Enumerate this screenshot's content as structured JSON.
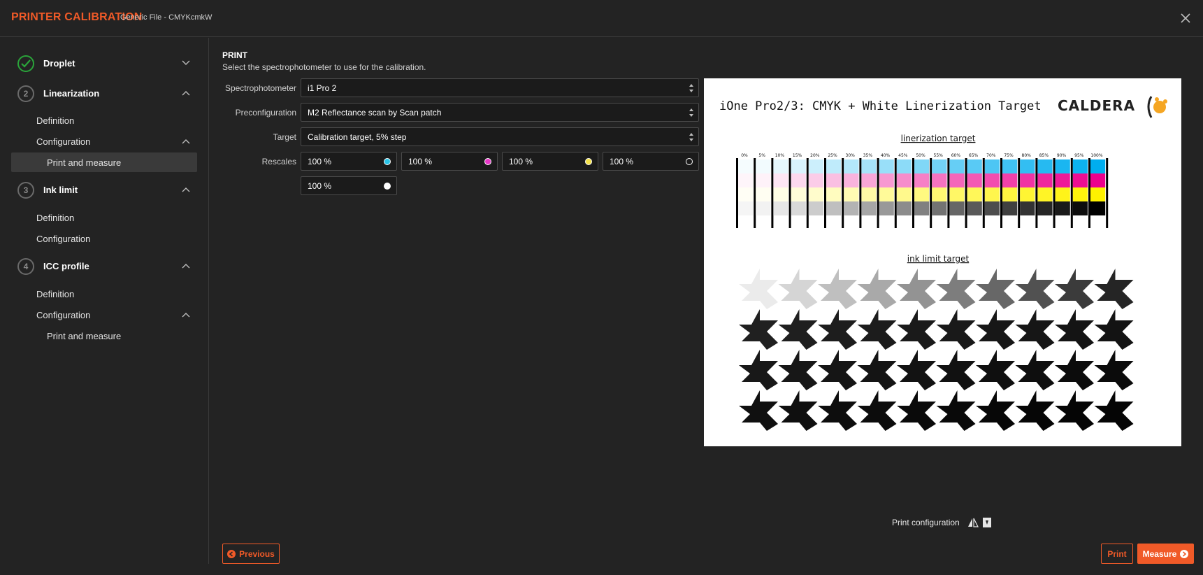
{
  "header": {
    "title": "PRINTER CALIBRATION",
    "subtitle": "Generic File - CMYKcmkW",
    "close_icon": "close-icon"
  },
  "sidebar": {
    "steps": [
      {
        "number": "",
        "label": "Droplet",
        "status": "done",
        "expanded": false
      },
      {
        "number": "2",
        "label": "Linearization",
        "status": "pending",
        "expanded": true,
        "items": [
          {
            "label": "Definition"
          },
          {
            "label": "Configuration",
            "expanded": true,
            "children": [
              {
                "label": "Print and measure",
                "active": true
              }
            ]
          }
        ]
      },
      {
        "number": "3",
        "label": "Ink limit",
        "status": "pending",
        "expanded": true,
        "items": [
          {
            "label": "Definition"
          },
          {
            "label": "Configuration"
          }
        ]
      },
      {
        "number": "4",
        "label": "ICC profile",
        "status": "pending",
        "expanded": true,
        "items": [
          {
            "label": "Definition"
          },
          {
            "label": "Configuration",
            "expanded": true,
            "children": [
              {
                "label": "Print and measure"
              }
            ]
          }
        ]
      }
    ]
  },
  "main": {
    "section_title": "PRINT",
    "section_desc": "Select the spectrophotometer to use for the calibration.",
    "fields": {
      "spectrophotometer": {
        "label": "Spectrophotometer",
        "value": "i1 Pro 2"
      },
      "preconfiguration": {
        "label": "Preconfiguration",
        "value": "M2 Reflectance scan by Scan patch"
      },
      "target": {
        "label": "Target",
        "value": "Calibration target, 5% step"
      },
      "rescales": {
        "label": "Rescales",
        "items": [
          {
            "value": "100 %",
            "color": "#29c4e8",
            "ink": "cyan"
          },
          {
            "value": "100 %",
            "color": "#e838c8",
            "ink": "magenta"
          },
          {
            "value": "100 %",
            "color": "#f4e24a",
            "ink": "yellow"
          },
          {
            "value": "100 %",
            "color": "#ffffff",
            "ink": "black-outline"
          },
          {
            "value": "100 %",
            "color": "#ffffff",
            "ink": "white"
          }
        ]
      }
    },
    "preview": {
      "title": "iOne Pro2/3: CMYK + White Linerization Target",
      "logo": "CALDERA",
      "lin_heading": "linerization target",
      "ink_heading": "ink limit target",
      "percent_labels": [
        "0%",
        "5%",
        "10%",
        "15%",
        "20%",
        "25%",
        "30%",
        "35%",
        "40%",
        "45%",
        "50%",
        "55%",
        "60%",
        "65%",
        "70%",
        "75%",
        "80%",
        "85%",
        "90%",
        "95%",
        "100%"
      ],
      "patch_colors": {
        "cyan": "#00aeef",
        "magenta": "#ec008c",
        "yellow": "#fff200",
        "gray": "#000000"
      }
    },
    "print_configuration_label": "Print configuration",
    "buttons": {
      "previous": "Previous",
      "print": "Print",
      "measure": "Measure"
    }
  }
}
